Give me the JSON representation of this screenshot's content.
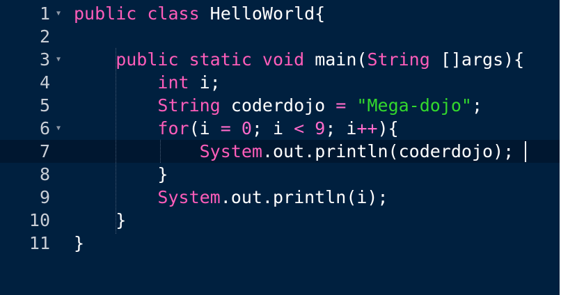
{
  "editor": {
    "lines": [
      {
        "num": "1",
        "fold": true,
        "tokens": [
          {
            "t": "public class ",
            "c": "kw"
          },
          {
            "t": "HelloWorld{",
            "c": "plain"
          }
        ]
      },
      {
        "num": "2",
        "fold": false,
        "tokens": []
      },
      {
        "num": "3",
        "fold": true,
        "tokens": [
          {
            "t": "    public static void ",
            "c": "kw"
          },
          {
            "t": "main(",
            "c": "plain"
          },
          {
            "t": "String",
            "c": "kw"
          },
          {
            "t": " []args){",
            "c": "plain"
          }
        ]
      },
      {
        "num": "4",
        "fold": false,
        "tokens": [
          {
            "t": "        int",
            "c": "kw"
          },
          {
            "t": " i;",
            "c": "plain"
          }
        ]
      },
      {
        "num": "5",
        "fold": false,
        "tokens": [
          {
            "t": "        String",
            "c": "kw"
          },
          {
            "t": " coderdojo ",
            "c": "plain"
          },
          {
            "t": "=",
            "c": "op"
          },
          {
            "t": " ",
            "c": "plain"
          },
          {
            "t": "\"Mega-dojo\"",
            "c": "str"
          },
          {
            "t": ";",
            "c": "plain"
          }
        ]
      },
      {
        "num": "6",
        "fold": true,
        "tokens": [
          {
            "t": "        for",
            "c": "kw"
          },
          {
            "t": "(i ",
            "c": "plain"
          },
          {
            "t": "=",
            "c": "op"
          },
          {
            "t": " ",
            "c": "plain"
          },
          {
            "t": "0",
            "c": "num"
          },
          {
            "t": "; i ",
            "c": "plain"
          },
          {
            "t": "<",
            "c": "op"
          },
          {
            "t": " ",
            "c": "plain"
          },
          {
            "t": "9",
            "c": "num"
          },
          {
            "t": "; i",
            "c": "plain"
          },
          {
            "t": "++",
            "c": "op"
          },
          {
            "t": "){",
            "c": "plain"
          }
        ]
      },
      {
        "num": "7",
        "fold": false,
        "tokens": [
          {
            "t": "            System",
            "c": "kw"
          },
          {
            "t": ".out.println(coderdojo);",
            "c": "plain"
          }
        ]
      },
      {
        "num": "8",
        "fold": false,
        "tokens": [
          {
            "t": "        }",
            "c": "plain"
          }
        ]
      },
      {
        "num": "9",
        "fold": false,
        "tokens": [
          {
            "t": "        System",
            "c": "kw"
          },
          {
            "t": ".out.println(i);",
            "c": "plain"
          }
        ]
      },
      {
        "num": "10",
        "fold": false,
        "tokens": [
          {
            "t": "    }",
            "c": "plain"
          }
        ]
      },
      {
        "num": "11",
        "fold": false,
        "tokens": [
          {
            "t": "}",
            "c": "plain"
          }
        ]
      }
    ],
    "active_line": "7"
  },
  "colors": {
    "background": "#00203f",
    "active_line": "#001730",
    "keyword": "#ff5dba",
    "string": "#33d82d",
    "number": "#ff6bcb",
    "text": "#ffffff",
    "line_number": "#c9ced6"
  }
}
